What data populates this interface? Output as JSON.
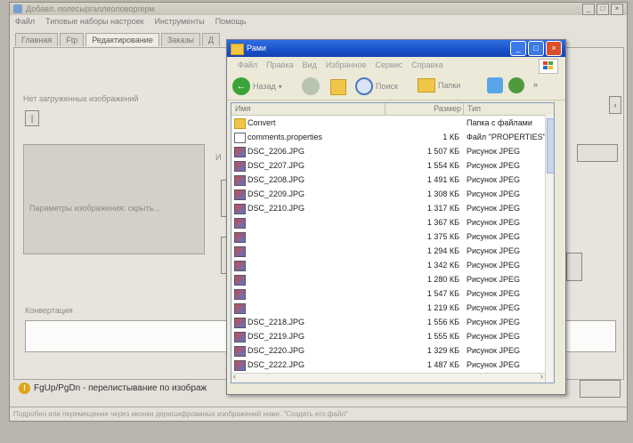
{
  "main_window": {
    "title": "Добавл. полесыргаллеоловоргерм",
    "menu": [
      "Файл",
      "Типовые наборы настроек",
      "Инструменты",
      "Помощь"
    ],
    "tabs": [
      "Главная",
      "Ftp",
      "Редактирование",
      "Заказы",
      "Д"
    ],
    "active_tab": "Редактирование",
    "not_loaded_label": "Нет загруженных изображений",
    "params_label": "Параметры изображения: скрыть...",
    "conversion_label": "Конвертация",
    "hint_text": "FgUp/PgDn - перелистывание по изображ",
    "status_text": "Подробно или перемещение через иконки деришифрованых изображений ниже. \"Создать его файл\""
  },
  "explorer": {
    "title": "Рами",
    "menu": [
      "Файл",
      "Правка",
      "Вид",
      "Избранное",
      "Сервис",
      "Справка"
    ],
    "toolbar": {
      "back": "Назад",
      "search": "Поиск",
      "folders": "Папки"
    },
    "columns": {
      "name": "Имя",
      "size": "Размер",
      "type": "Тип"
    },
    "files": [
      {
        "name": "Convert",
        "size": "",
        "type": "Папка с файлами",
        "icon": "folder-icon",
        "selected": false
      },
      {
        "name": "comments.properties",
        "size": "1 КБ",
        "type": "Файл \"PROPERTIES\"",
        "icon": "text-file-icon",
        "selected": false
      },
      {
        "name": "DSC_2206.JPG",
        "size": "1 507 КБ",
        "type": "Рисунок JPEG",
        "icon": "image-icon",
        "selected": false
      },
      {
        "name": "DSC_2207.JPG",
        "size": "1 554 КБ",
        "type": "Рисунок JPEG",
        "icon": "image-icon",
        "selected": false
      },
      {
        "name": "DSC_2208.JPG",
        "size": "1 491 КБ",
        "type": "Рисунок JPEG",
        "icon": "image-icon",
        "selected": false
      },
      {
        "name": "DSC_2209.JPG",
        "size": "1 308 КБ",
        "type": "Рисунок JPEG",
        "icon": "image-icon",
        "selected": false
      },
      {
        "name": "DSC_2210.JPG",
        "size": "1 317 КБ",
        "type": "Рисунок JPEG",
        "icon": "image-icon",
        "selected": false
      },
      {
        "name": "",
        "size": "1 367 КБ",
        "type": "Рисунок JPEG",
        "icon": "image-icon",
        "selected": true
      },
      {
        "name": "",
        "size": "1 375 КБ",
        "type": "Рисунок JPEG",
        "icon": "image-icon",
        "selected": true
      },
      {
        "name": "",
        "size": "1 294 КБ",
        "type": "Рисунок JPEG",
        "icon": "image-icon",
        "selected": true
      },
      {
        "name": "",
        "size": "1 342 КБ",
        "type": "Рисунок JPEG",
        "icon": "image-icon",
        "selected": true
      },
      {
        "name": "",
        "size": "1 280 КБ",
        "type": "Рисунок JPEG",
        "icon": "image-icon",
        "selected": true
      },
      {
        "name": "",
        "size": "1 547 КБ",
        "type": "Рисунок JPEG",
        "icon": "image-icon",
        "selected": true
      },
      {
        "name": "",
        "size": "1 219 КБ",
        "type": "Рисунок JPEG",
        "icon": "image-icon",
        "selected": true
      },
      {
        "name": "DSC_2218.JPG",
        "size": "1 556 КБ",
        "type": "Рисунок JPEG",
        "icon": "image-icon",
        "selected": false
      },
      {
        "name": "DSC_2219.JPG",
        "size": "1 555 КБ",
        "type": "Рисунок JPEG",
        "icon": "image-icon",
        "selected": false
      },
      {
        "name": "DSC_2220.JPG",
        "size": "1 329 КБ",
        "type": "Рисунок JPEG",
        "icon": "image-icon",
        "selected": false
      },
      {
        "name": "DSC_2222.JPG",
        "size": "1 487 КБ",
        "type": "Рисунок JPEG",
        "icon": "image-icon",
        "selected": false
      }
    ]
  },
  "colors": {
    "selection": "#233a86",
    "titlebar": "#1a4fc7",
    "close": "#d9502b"
  }
}
